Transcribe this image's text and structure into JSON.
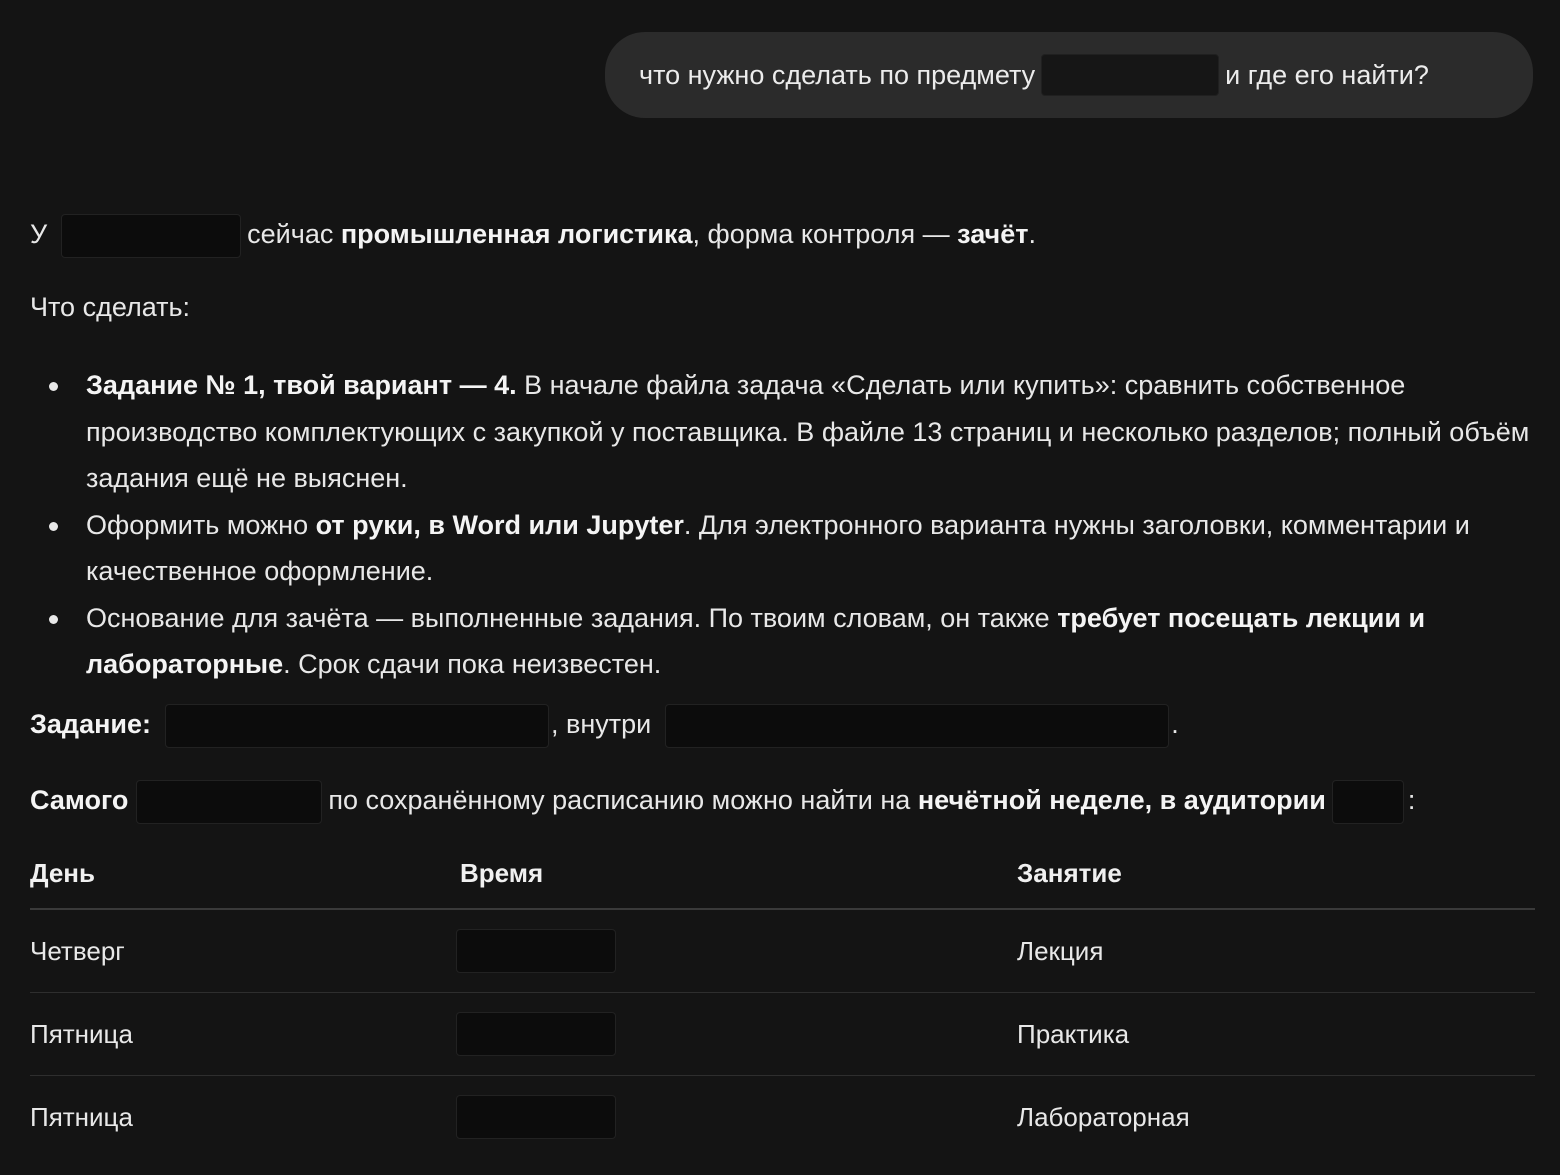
{
  "user_message": {
    "before": "что нужно сделать по предмету",
    "after": "и где его найти?"
  },
  "reply": {
    "line1": {
      "prefix": "У",
      "middle": "сейчас",
      "subject": "промышленная логистика",
      "control_text": ", форма контроля —",
      "control_value": "зачёт",
      "end": "."
    },
    "what_to_do": "Что сделать:",
    "bullets": [
      {
        "bold": "Задание № 1, твой вариант — 4.",
        "text": " В начале файла задача «Сделать или купить»: сравнить собственное производство комплектующих с закупкой у поставщика. В файле 13 страниц и несколько разделов; полный объём задания ещё не выяснен."
      },
      {
        "pre": "Оформить можно ",
        "bold": "от руки, в Word или Jupyter",
        "text": ". Для электронного варианта нужны заголовки, комментарии и качественное оформление."
      },
      {
        "pre": "Основание для зачёта — выполненные задания. По твоим словам, он также ",
        "bold": "требует посещать лекции и лабораторные",
        "text": ". Срок сдачи пока неизвестен."
      }
    ],
    "task_line": {
      "label": "Задание:",
      "inside": ", внутри",
      "end": "."
    },
    "find_line": {
      "label": "Самого",
      "text": "по сохранённому расписанию можно найти на",
      "bold": "нечётной неделе, в аудитории",
      "end": ":"
    },
    "schedule": {
      "headers": [
        "День",
        "Время",
        "Занятие"
      ],
      "rows": [
        {
          "day": "Четверг",
          "type": "Лекция"
        },
        {
          "day": "Пятница",
          "type": "Практика"
        },
        {
          "day": "Пятница",
          "type": "Лабораторная"
        }
      ]
    }
  }
}
